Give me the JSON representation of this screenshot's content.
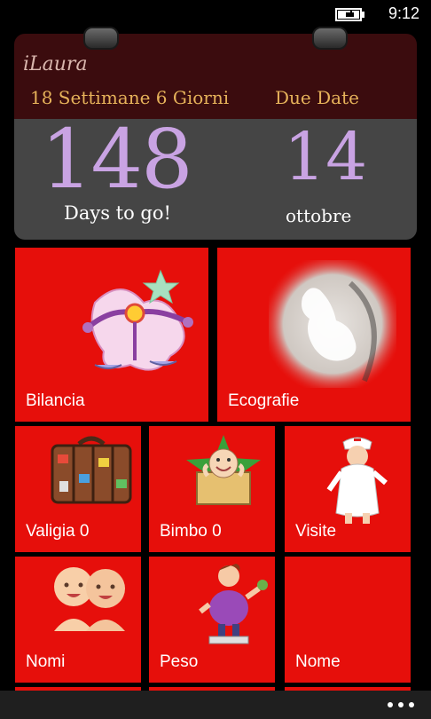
{
  "status_bar": {
    "time": "9:12",
    "battery_icon": "battery-charging-icon"
  },
  "calendar": {
    "user": "iLaura",
    "week_text": "18 Settimane 6 Giorni",
    "due_label": "Due Date",
    "days_left": "148",
    "days_label": "Days to go!",
    "due_day": "14",
    "due_month": "ottobre"
  },
  "tiles": [
    {
      "label": "Bilancia",
      "icon": "libra-icon"
    },
    {
      "label": "Ecografie",
      "icon": "ultrasound-image"
    },
    {
      "label": "Valigia 0",
      "icon": "suitcase-icon"
    },
    {
      "label": "Bimbo 0",
      "icon": "baby-in-box-icon"
    },
    {
      "label": "Visite",
      "icon": "nurse-icon"
    },
    {
      "label": "Nomi",
      "icon": "twin-babies-icon"
    },
    {
      "label": "Peso",
      "icon": "weight-lady-icon"
    },
    {
      "label": "Nome",
      "icon": ""
    }
  ],
  "colors": {
    "tile": "#e60f0b",
    "calendar_top": "#3b0c0e",
    "calendar_bottom": "#454545",
    "accent_number": "#c9a3e3",
    "gold_text": "#e6b25a"
  },
  "app_bar": {
    "more_icon": "more-dots-icon"
  }
}
